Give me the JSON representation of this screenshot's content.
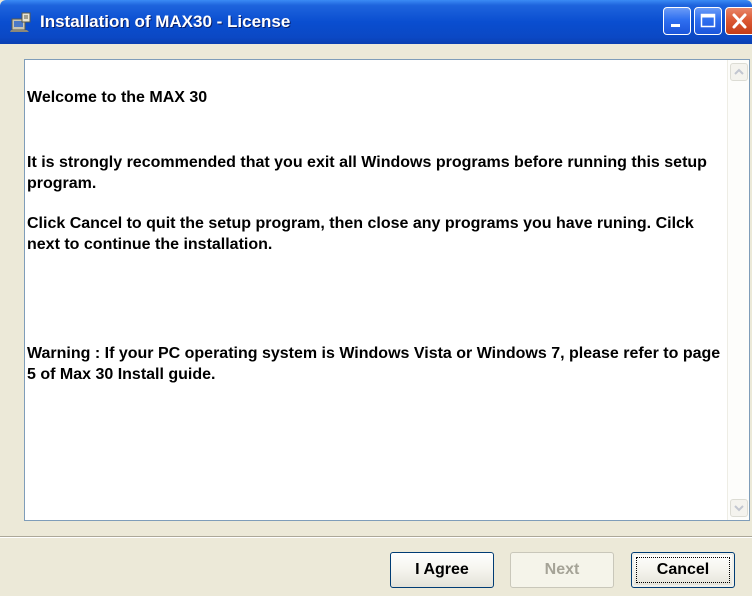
{
  "window": {
    "title": "Installation of MAX30 - License",
    "icon": "installer-icon"
  },
  "titlebar_buttons": {
    "minimize_icon": "minimize-icon",
    "maximize_icon": "maximize-icon",
    "close_icon": "close-icon"
  },
  "content": {
    "welcome": "Welcome to the MAX 30",
    "recommendation": "It is strongly recommended that you exit all Windows programs before running this setup program.",
    "instructions": "Click Cancel to quit the setup program, then close any programs you have runing. Cilck next to continue the installation.",
    "warning": "Warning : If your PC operating system is Windows Vista or Windows 7, please refer to page 5 of Max 30 Install guide."
  },
  "buttons": {
    "agree": "I Agree",
    "next": "Next",
    "cancel": "Cancel"
  },
  "colors": {
    "titlebar": "#0a4ed0",
    "dialog_background": "#ece9d8",
    "close_button": "#c53c18",
    "disabled_text": "#a5a397"
  }
}
